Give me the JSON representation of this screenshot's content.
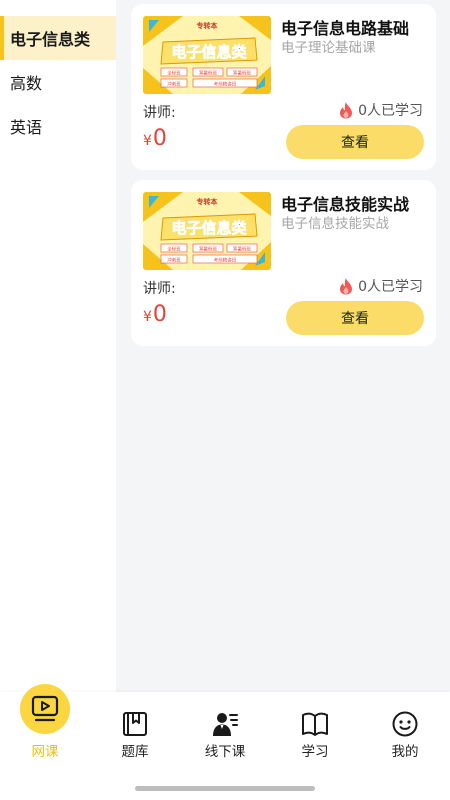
{
  "sidebar": {
    "items": [
      {
        "label": "电子信息类",
        "active": true
      },
      {
        "label": "高数",
        "active": false
      },
      {
        "label": "英语",
        "active": false
      }
    ]
  },
  "courses": [
    {
      "thumb": {
        "badge": "专转本",
        "headline": "电子信息类",
        "tags": [
          "全程班",
          "寒暑假班",
          "冲刺班",
          "考前精讲班"
        ]
      },
      "title": "电子信息电路基础",
      "subtitle": "电子理论基础课",
      "teacher_label": "讲师:",
      "learners": "0人已学习",
      "currency": "¥",
      "price": "0",
      "view_label": "查看"
    },
    {
      "thumb": {
        "badge": "专转本",
        "headline": "电子信息类",
        "tags": [
          "全程班",
          "寒暑假班",
          "冲刺班",
          "考前精讲班"
        ]
      },
      "title": "电子信息技能实战",
      "subtitle": "电子信息技能实战",
      "teacher_label": "讲师:",
      "learners": "0人已学习",
      "currency": "¥",
      "price": "0",
      "view_label": "查看"
    }
  ],
  "tabbar": {
    "items": [
      {
        "label": "网课",
        "icon": "video-icon",
        "active": true
      },
      {
        "label": "题库",
        "icon": "bookmark-book-icon",
        "active": false
      },
      {
        "label": "线下课",
        "icon": "teacher-icon",
        "active": false
      },
      {
        "label": "学习",
        "icon": "open-book-icon",
        "active": false
      },
      {
        "label": "我的",
        "icon": "smile-icon",
        "active": false
      }
    ]
  },
  "colors": {
    "accent": "#f6c21c",
    "button": "#fbdc69",
    "price": "#e8403b",
    "active_tab_label": "#f1bc1a"
  }
}
